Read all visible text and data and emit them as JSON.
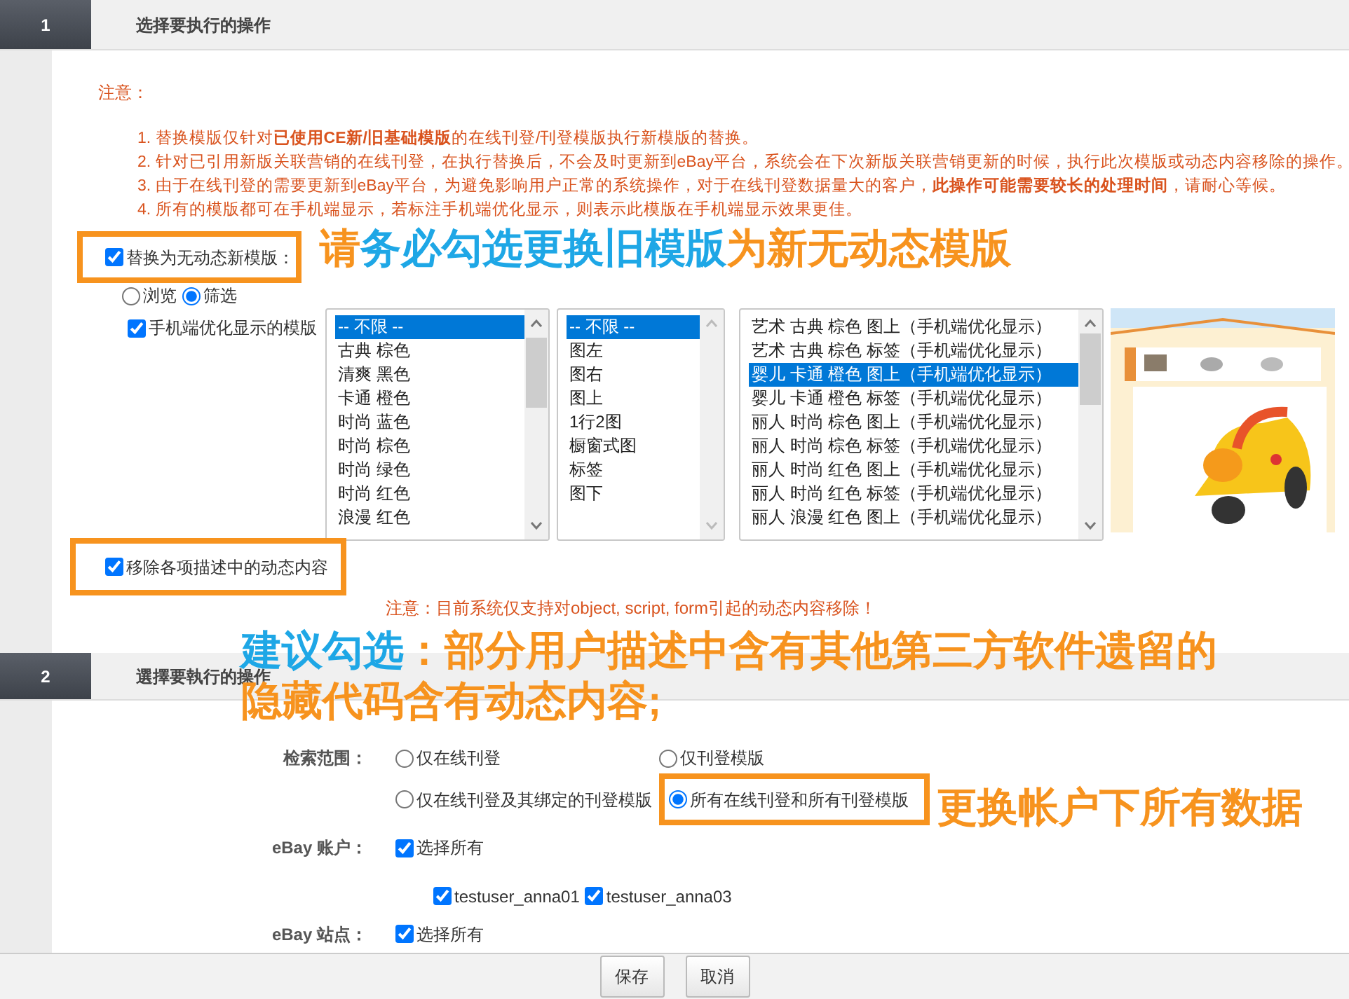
{
  "section_1": {
    "number": "1",
    "title": "选择要执行的操作",
    "notice": {
      "heading": "注意：",
      "items": [
        "1. 替换模版仅针对**已使用CE新/旧基础模版**的在线刊登/刊登模版执行新模版的替换。",
        "2. 针对已引用新版关联营销的在线刊登，在执行替换后，不会及时更新到eBay平台，系统会在下次新版关联营销更新的时候，执行此次模版或动态内容移除的操作。",
        "3. 由于在线刊登的需要更新到eBay平台，为避免影响用户正常的系统操作，对于在线刊登数据量大的客户，**此操作可能需要较长的处理时间**，请耐心等候。",
        "4. 所有的模版都可在手机端显示，若标注手机端优化显示，则表示此模版在手机端显示效果更佳。"
      ]
    },
    "replace_template": {
      "label": "替换为无动态新模版：",
      "checked": true
    },
    "mode_options": [
      {
        "label": "浏览",
        "selected": false
      },
      {
        "label": "筛选",
        "selected": true
      }
    ],
    "mobile_filter": {
      "label": "手机端优化显示的模版",
      "checked": true
    },
    "lists": [
      {
        "options": [
          {
            "label": "-- 不限 --",
            "selected": true
          },
          {
            "label": "古典 棕色",
            "selected": false
          },
          {
            "label": "清爽 黑色",
            "selected": false
          },
          {
            "label": "卡通 橙色",
            "selected": false
          },
          {
            "label": "时尚 蓝色",
            "selected": false
          },
          {
            "label": "时尚 棕色",
            "selected": false
          },
          {
            "label": "时尚 绿色",
            "selected": false
          },
          {
            "label": "时尚 红色",
            "selected": false
          },
          {
            "label": "浪漫 红色",
            "selected": false
          }
        ]
      },
      {
        "options": [
          {
            "label": "-- 不限 --",
            "selected": true
          },
          {
            "label": "图左",
            "selected": false
          },
          {
            "label": "图右",
            "selected": false
          },
          {
            "label": "图上",
            "selected": false
          },
          {
            "label": "1行2图",
            "selected": false
          },
          {
            "label": "橱窗式图",
            "selected": false
          },
          {
            "label": "标签",
            "selected": false
          },
          {
            "label": "图下",
            "selected": false
          }
        ]
      },
      {
        "options": [
          {
            "label": "艺术 古典 棕色 图上（手机端优化显示）",
            "selected": false
          },
          {
            "label": "艺术 古典 棕色 标签（手机端优化显示）",
            "selected": false
          },
          {
            "label": "婴儿 卡通 橙色 图上（手机端优化显示）",
            "selected": true
          },
          {
            "label": "婴儿 卡通 橙色 标签（手机端优化显示）",
            "selected": false
          },
          {
            "label": "丽人 时尚 棕色 图上（手机端优化显示）",
            "selected": false
          },
          {
            "label": "丽人 时尚 棕色 标签（手机端优化显示）",
            "selected": false
          },
          {
            "label": "丽人 时尚 红色 图上（手机端优化显示）",
            "selected": false
          },
          {
            "label": "丽人 时尚 红色 标签（手机端优化显示）",
            "selected": false
          },
          {
            "label": "丽人 浪漫 红色 图上（手机端优化显示）",
            "selected": false
          }
        ]
      }
    ],
    "remove_dynamic": {
      "label": "移除各项描述中的动态内容",
      "checked": true
    },
    "remove_note": "注意：目前系统仅支持对object, script, form引起的动态内容移除！"
  },
  "section_2": {
    "number": "2",
    "title": "選擇要執行的操作",
    "fields": [
      {
        "label": "检索范围：",
        "kind": "radios",
        "options": [
          {
            "label": "仅在线刊登",
            "selected": false
          },
          {
            "label": "仅刊登模版",
            "selected": false
          },
          {
            "label": "仅在线刊登及其绑定的刊登模版",
            "selected": false
          },
          {
            "label": "所有在线刊登和所有刊登模版",
            "selected": true
          }
        ]
      },
      {
        "label": "eBay 账户：",
        "kind": "checks",
        "select_all": {
          "label": "选择所有",
          "checked": true
        },
        "options": [
          {
            "label": "testuser_anna01",
            "checked": true
          },
          {
            "label": "testuser_anna03",
            "checked": true
          }
        ]
      },
      {
        "label": "eBay 站点：",
        "kind": "checks",
        "select_all": {
          "label": "选择所有",
          "checked": true
        }
      }
    ]
  },
  "footer": {
    "buttons": [
      "保存",
      "取消"
    ]
  },
  "callouts": [
    {
      "lines": [
        [
          {
            "text": "请",
            "color": "#f7931e"
          },
          {
            "text": "务必勾选更换旧模版",
            "color": "#1ea7e6"
          },
          {
            "text": "为新无动态模版",
            "color": "#f7931e"
          }
        ]
      ]
    },
    {
      "lines": [
        [
          {
            "text": "建议勾选",
            "color": "#1ea7e6"
          },
          {
            "text": "：部分用户描述中含有其他第三方软件遗留的",
            "color": "#f7931e"
          }
        ],
        [
          {
            "text": "隐藏代码含有动态内容;",
            "color": "#f7931e"
          }
        ]
      ]
    },
    {
      "lines": [
        [
          {
            "text": "更换帐户下所有数据",
            "color": "#f7931e"
          }
        ]
      ]
    }
  ]
}
